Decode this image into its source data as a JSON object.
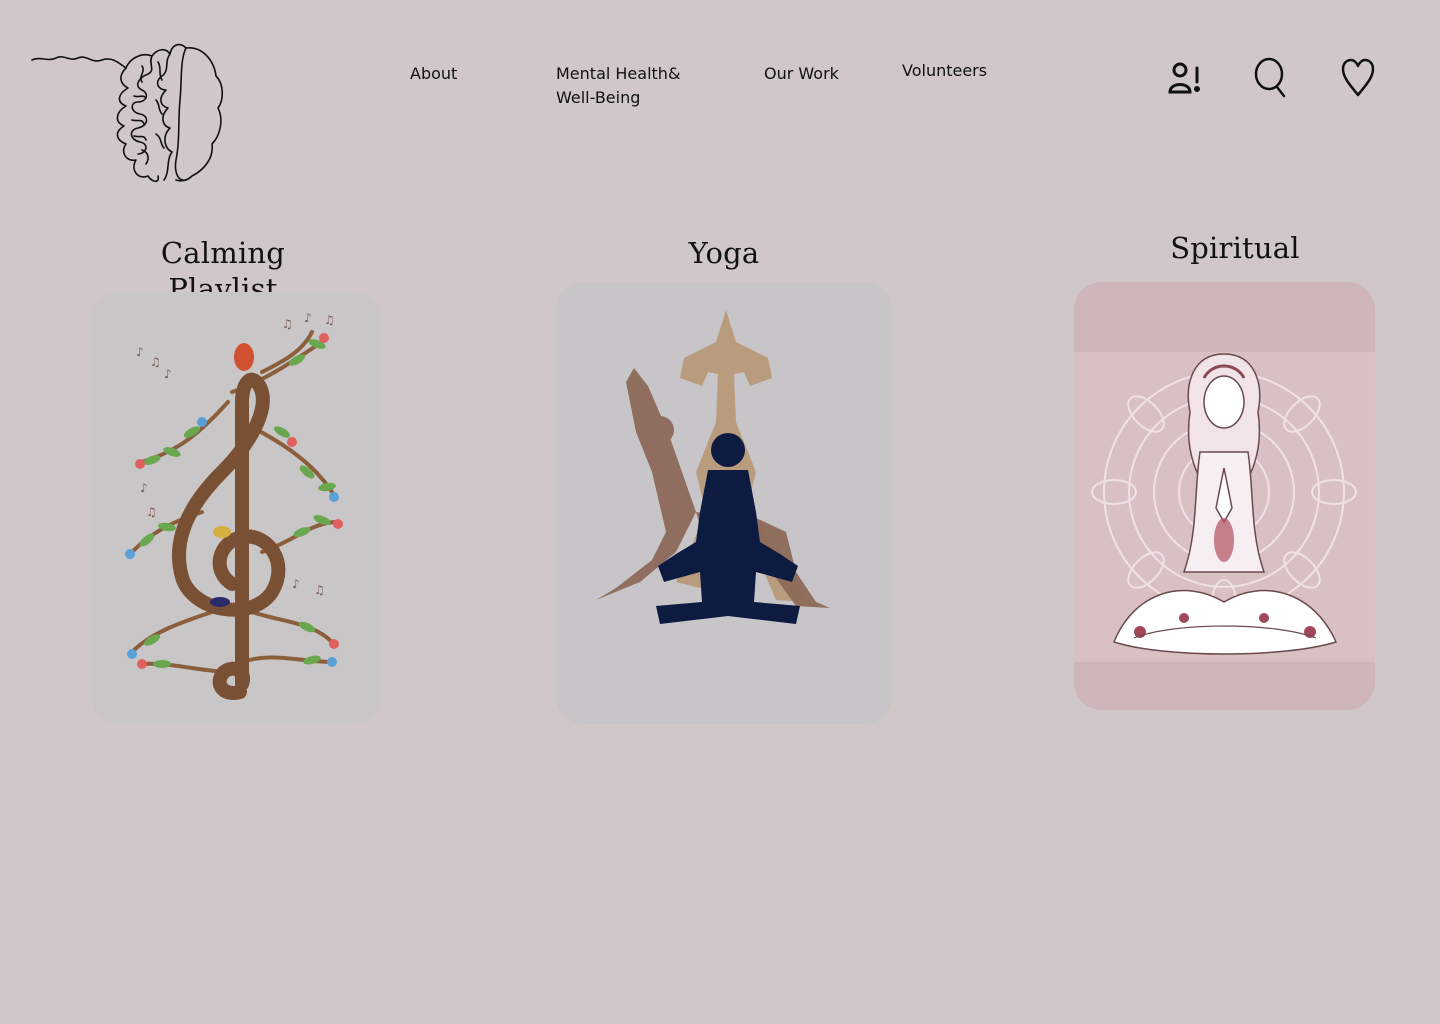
{
  "nav": {
    "about": "About",
    "mental_health": "Mental Health& Well-Being",
    "our_work": "Our Work",
    "volunteers": "Volunteers"
  },
  "header_icons": [
    "user-alert-icon",
    "search-icon",
    "heart-icon"
  ],
  "cards": [
    {
      "title": "Calming  Playlist",
      "image": "treble-clef-tree-illustration"
    },
    {
      "title": "Yoga",
      "image": "yoga-silhouettes-illustration"
    },
    {
      "title": "Spiritual",
      "image": "meditating-woman-mandala-illustration"
    }
  ],
  "colors": {
    "background": "#d1c6c8",
    "text": "#111111",
    "card_grey": "#c8c6c7",
    "card_pink": "#cdb5b8",
    "navy": "#0d1b40",
    "tan": "#b09070",
    "brown": "#8b5e3c"
  }
}
